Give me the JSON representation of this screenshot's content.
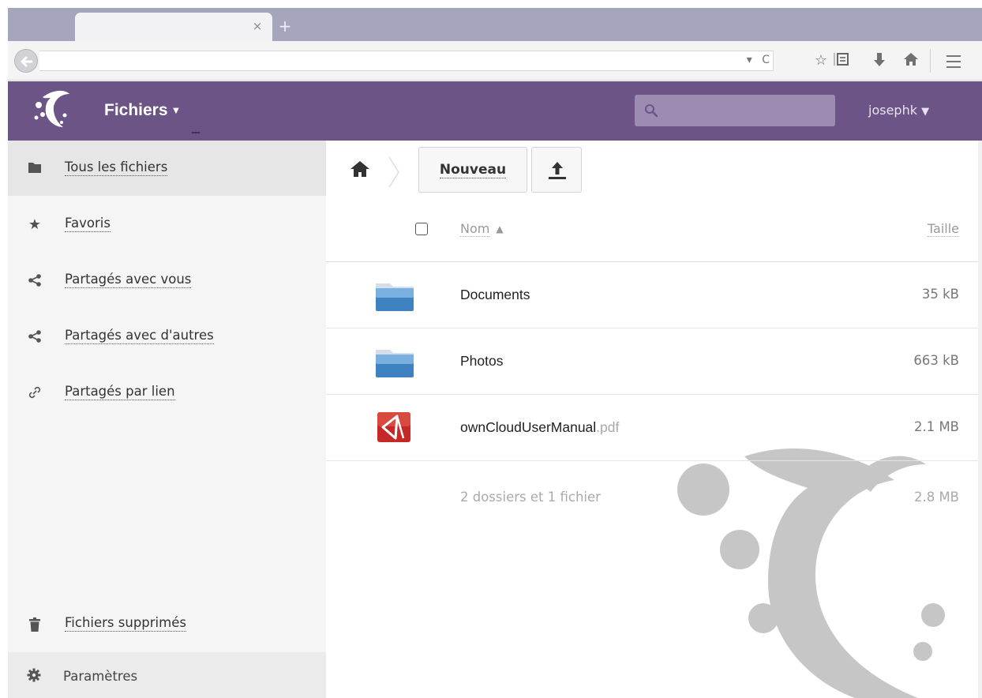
{
  "browser": {
    "tab_close": "×",
    "new_tab": "+",
    "url_tools": {
      "dropdown": "▾",
      "reload": "C"
    }
  },
  "header": {
    "app_name": "Fichiers",
    "app_caret": "▼",
    "user": "josephk",
    "user_caret": "▼",
    "accent_color": "#6c5487"
  },
  "sidebar": {
    "items": [
      {
        "label": "Tous les fichiers",
        "icon": "folder-icon",
        "active": true
      },
      {
        "label": "Favoris",
        "icon": "star-icon",
        "active": false
      },
      {
        "label": "Partagés avec vous",
        "icon": "share-icon",
        "active": false
      },
      {
        "label": "Partagés avec d'autres",
        "icon": "share-icon",
        "active": false
      },
      {
        "label": "Partagés par lien",
        "icon": "link-icon",
        "active": false
      }
    ],
    "trash_label": "Fichiers supprimés",
    "settings_label": "Paramètres"
  },
  "toolbar": {
    "new_label": "Nouveau"
  },
  "table": {
    "col_name": "Nom",
    "col_name_sort": "▲",
    "col_size": "Taille",
    "rows": [
      {
        "name": "Documents",
        "ext": "",
        "size": "35 kB",
        "type": "folder"
      },
      {
        "name": "Photos",
        "ext": "",
        "size": "663 kB",
        "type": "folder"
      },
      {
        "name": "ownCloudUserManual",
        "ext": ".pdf",
        "size": "2.1 MB",
        "type": "pdf"
      }
    ],
    "summary": "2 dossiers et 1 fichier",
    "summary_size": "2.8 MB"
  }
}
